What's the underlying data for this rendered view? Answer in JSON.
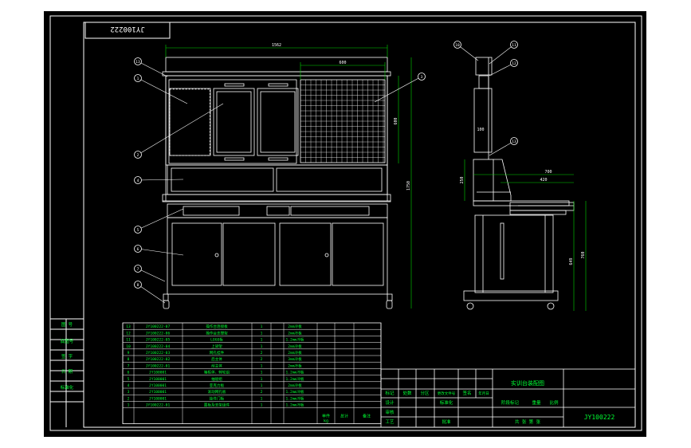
{
  "drawing": {
    "background": "#000000",
    "viewport_bg": "#ffffff",
    "line_color": "#ffffff",
    "dim_color": "#00d400",
    "table_text_color": "#00ff33",
    "frame_code": "JY100222",
    "title_code": "JY100222",
    "product_name": "实训台装配图",
    "dimensions": {
      "overall_width": "1562",
      "panel_width": "600",
      "panel_height": "600",
      "total_height": "1750",
      "side_top_height": "100",
      "side_depth": "700",
      "side_shelf": "420",
      "side_small": "250",
      "cabinet_height_a": "649",
      "cabinet_height_b": "760"
    },
    "balloons_front": [
      "13",
      "1",
      "2",
      "3",
      "4",
      "5",
      "6",
      "7",
      "8"
    ],
    "balloons_side": [
      "10",
      "11",
      "12",
      "13"
    ],
    "parts": [
      {
        "no": "13",
        "code": "JY100222-07",
        "name": "操作台连接板",
        "qty": "1",
        "spec": "2mm冷板"
      },
      {
        "no": "12",
        "code": "JY100222-06",
        "name": "操作台支撑架",
        "qty": "1",
        "spec": "2mm冷板"
      },
      {
        "no": "11",
        "code": "JY100222-05",
        "name": "LOGO板",
        "qty": "1",
        "spec": "1.2mm冷板"
      },
      {
        "no": "10",
        "code": "JY100222-04",
        "name": "上梁架",
        "qty": "1",
        "spec": "2mm冷板"
      },
      {
        "no": "9",
        "code": "JY100222-03",
        "name": "网孔挂件",
        "qty": "2",
        "spec": "2mm冷板"
      },
      {
        "no": "8",
        "code": "JY100222-02",
        "name": "后主体",
        "qty": "2",
        "spec": "3mm冷板"
      },
      {
        "no": "7",
        "code": "JY100222-01",
        "name": "前主体",
        "qty": "1",
        "spec": "2mm冷板"
      },
      {
        "no": "6",
        "code": "JY100001",
        "name": "箱柜体、转轮组",
        "qty": "1",
        "spec": "1.2mm冷板"
      },
      {
        "no": "5",
        "code": "JY100001",
        "name": "抽屉组",
        "qty": "1",
        "spec": "1.2mm冷板"
      },
      {
        "no": "4",
        "code": "JY100001",
        "name": "亚克力板",
        "qty": "1",
        "spec": "2mm冷板"
      },
      {
        "no": "3",
        "code": "JY100001",
        "name": "滚动网孔板",
        "qty": "2",
        "spec": "1.2mm冷板"
      },
      {
        "no": "2",
        "code": "JY100001",
        "name": "挂件门板",
        "qty": "1",
        "spec": "1.2mm冷板"
      },
      {
        "no": "1",
        "code": "JY100222-01",
        "name": "面板及支架组件",
        "qty": "1",
        "spec": "1.2mm冷板"
      }
    ],
    "bom_footer": {
      "weight_label": "单件",
      "total_label": "总计",
      "remark_label": "备注",
      "unit": "kg"
    },
    "left_strip_labels": [
      "图 号",
      "底图号",
      "签 字",
      "日 期",
      "标准化"
    ],
    "title_block": {
      "mark_label": "标记",
      "count_label": "处数",
      "zone_label": "分区",
      "doc_label": "更改文件号",
      "sign_label": "签名",
      "date_label": "年月日",
      "designer_label": "设计",
      "standard_label": "标准化",
      "review_label": "审核",
      "process_label": "工艺",
      "approve_label": "批准",
      "stage_label": "阶段标记",
      "weight_label": "重量",
      "scale_label": "比例",
      "sheet_label": "共  张  第  张"
    }
  }
}
